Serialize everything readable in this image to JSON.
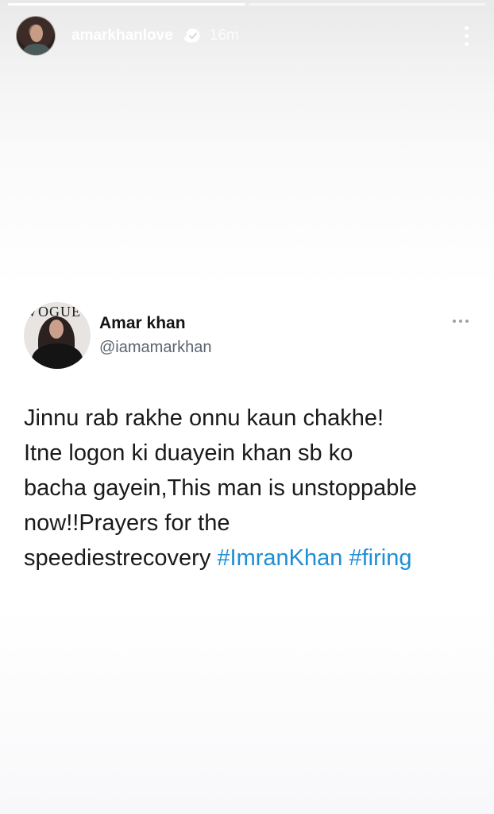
{
  "story": {
    "progress": [
      1.0,
      0.0
    ],
    "username": "amarkhanlove",
    "time": "16m",
    "verified": true,
    "icons": {
      "verified": "verified-badge-icon",
      "more": "more-vertical-icon"
    }
  },
  "tweet": {
    "display_name": "Amar khan",
    "handle": "@iamamarkhan",
    "avatar_text": "VOGUE",
    "text_body": "Jinnu rab rakhe onnu kaun chakhe!\nItne logon ki duayein khan sb ko\nbacha gayein,This man is unstoppable\nnow!!Prayers for the\nspeediestrecovery ",
    "hashtags": [
      "#ImranKhan",
      "#firing"
    ],
    "hashtag_color": "#1d8fd6",
    "icons": {
      "more": "more-horizontal-icon"
    }
  }
}
